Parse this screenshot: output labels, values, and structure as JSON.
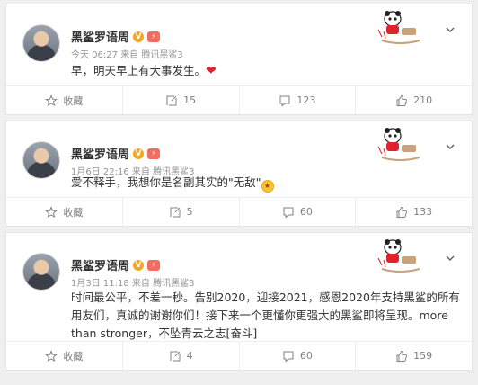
{
  "posts": [
    {
      "author": "黑鲨罗语周",
      "v_badge": "V",
      "time": "今天 06:27",
      "from_label": "来自",
      "source": "腾讯黑鲨3",
      "text": "早，明天早上有大事发生。",
      "text_emoji": "❤",
      "actions": {
        "favorite_label": "收藏",
        "reposts": "15",
        "comments": "123",
        "likes": "210"
      }
    },
    {
      "author": "黑鲨罗语周",
      "v_badge": "V",
      "time": "1月6日 22:16",
      "from_label": "来自",
      "source": "腾讯黑鲨3",
      "text": "爱不释手，我想你是名副其实的\"无敌\"",
      "actions": {
        "favorite_label": "收藏",
        "reposts": "5",
        "comments": "60",
        "likes": "133"
      }
    },
    {
      "author": "黑鲨罗语周",
      "v_badge": "V",
      "time": "1月3日 11:18",
      "from_label": "来自",
      "source": "腾讯黑鲨3",
      "text": "时间最公平，不差一秒。告别2020，迎接2021，感恩2020年支持黑鲨的所有用友们，真诚的谢谢你们！接下来一个更懂你更强大的黑鲨即将呈现。more than stronger，不坠青云之志[奋斗]",
      "actions": {
        "favorite_label": "收藏",
        "reposts": "4",
        "comments": "60",
        "likes": "159"
      }
    }
  ],
  "icons": {
    "verified": "verified-v-icon",
    "level": "level-badge-icon",
    "decoration": "panda-rocking-horse-decoration",
    "more": "chevron-down-icon",
    "favorite": "star-icon",
    "repost": "repost-icon",
    "comment": "comment-icon",
    "like": "thumbs-up-icon"
  },
  "colors": {
    "verified": "#f5a623",
    "heart": "#e0222a",
    "meta": "#939393",
    "action": "#808080"
  }
}
